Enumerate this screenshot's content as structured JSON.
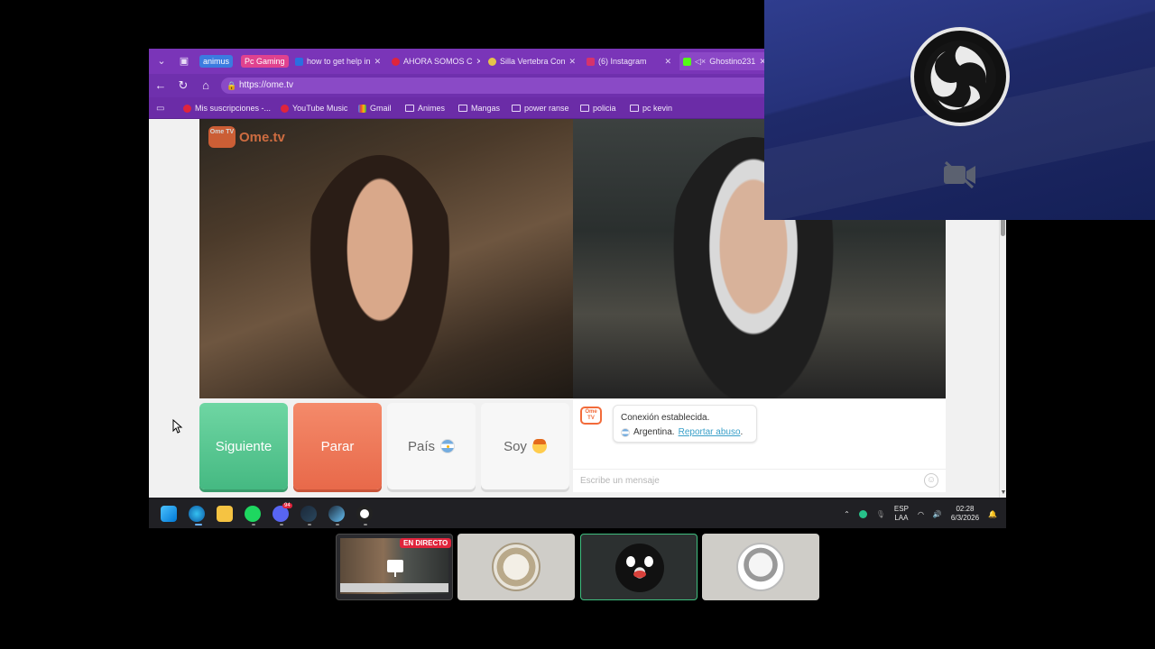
{
  "browser": {
    "tab_groups": [
      {
        "label": "animus",
        "color": "#3b7be0"
      },
      {
        "label": "Pc Gaming",
        "color": "#e0428f"
      }
    ],
    "tabs": [
      {
        "label": "how to get help in",
        "favicon_color": "#2b6fe0"
      },
      {
        "label": "AHORA SOMOS C",
        "favicon_color": "#e0243c"
      },
      {
        "label": "Silla Vertebra Con",
        "favicon_color": "#e6c44a"
      },
      {
        "label": "(6) Instagram",
        "favicon_color": "#d6336c"
      },
      {
        "label": "Ghostino231",
        "favicon_color": "#53fc18"
      }
    ],
    "url": "https://ome.tv",
    "bookmarks": [
      {
        "label": "Mis suscripciones -...",
        "icon": "youtube-icon",
        "color": "#e0243c"
      },
      {
        "label": "YouTube Music",
        "icon": "youtube-music-icon",
        "color": "#e0243c"
      },
      {
        "label": "Gmail",
        "icon": "gmail-icon",
        "color": "#ea4335"
      },
      {
        "label": "Animes",
        "icon": "folder-icon"
      },
      {
        "label": "Mangas",
        "icon": "folder-icon"
      },
      {
        "label": "power ranse",
        "icon": "folder-icon"
      },
      {
        "label": "policia",
        "icon": "folder-icon"
      },
      {
        "label": "pc kevin",
        "icon": "folder-icon"
      }
    ]
  },
  "ometv": {
    "logo_badge": "Ome TV",
    "logo_text": "Ome.tv",
    "buttons": {
      "next": "Siguiente",
      "stop": "Parar",
      "country": "País",
      "gender": "Soy"
    },
    "chat": {
      "logo_text": "Ome TV",
      "status": "Conexión establecida.",
      "country": "Argentina.",
      "report_link": "Reportar abuso",
      "report_suffix": ".",
      "input_placeholder": "Escribe un mensaje"
    }
  },
  "taskbar": {
    "icons": [
      "windows-start-icon",
      "edge-icon",
      "file-explorer-icon",
      "spotify-icon",
      "discord-icon",
      "steam-icon",
      "steam-alt-icon",
      "obs-icon"
    ],
    "discord_badge": "94",
    "language_line1": "ESP",
    "language_line2": "LAA",
    "time": "02:28",
    "date": "6/3/2026"
  },
  "call": {
    "live_badge": "EN DIRECTO",
    "participants": [
      {
        "name": "screen-share"
      },
      {
        "name": "participant-2"
      },
      {
        "name": "participant-3"
      },
      {
        "name": "participant-4"
      }
    ]
  },
  "colors": {
    "browser_purple": "#6b2fa8",
    "next_green": "#45b982",
    "stop_orange": "#e8694a",
    "obs_blue": "#26327a",
    "live_red": "#e0243c"
  }
}
